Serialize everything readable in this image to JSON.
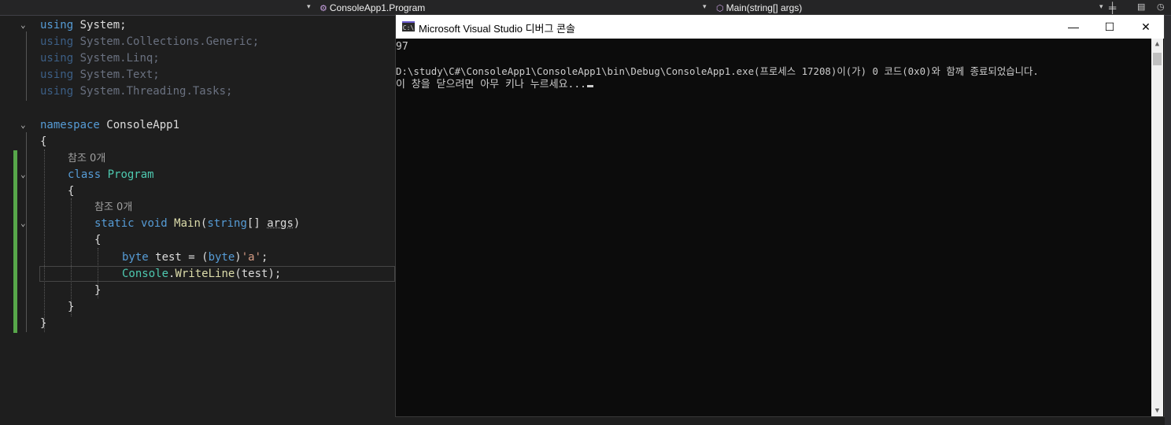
{
  "navbar": {
    "class_combo": "ConsoleApp1.Program",
    "member_combo": "Main(string[] args)",
    "split_icon": "split-icon"
  },
  "editor": {
    "lines": {
      "l1": {
        "kw": "using",
        "rest": " System;"
      },
      "l2": {
        "kw": "using",
        "rest": " System.Collections.Generic;"
      },
      "l3": {
        "kw": "using",
        "rest": " System.Linq;"
      },
      "l4": {
        "kw": "using",
        "rest": " System.Text;"
      },
      "l5": {
        "kw": "using",
        "rest": " System.Threading.Tasks;"
      },
      "l7": {
        "kw": "namespace",
        "rest": " ConsoleApp1"
      },
      "l8": "{",
      "ref1": "참조 0개",
      "l9": {
        "kw": "class",
        "type": "Program"
      },
      "l10": "{",
      "ref2": "참조 0개",
      "l11": {
        "kw1": "static",
        "kw2": "void",
        "meth": "Main",
        "p1": "(",
        "kw3": "string",
        "p2": "[] ",
        "param": "args",
        "p3": ")"
      },
      "l12": "{",
      "l13": {
        "kw": "byte",
        "id": " test = (",
        "kw2": "byte",
        "p": ")",
        "str": "'a'",
        "end": ";"
      },
      "l14": {
        "type": "Console",
        "dot": ".",
        "meth": "WriteLine",
        "args": "(test);"
      },
      "l15": "}",
      "l16": "}",
      "l17": "}"
    }
  },
  "console": {
    "title": "Microsoft Visual Studio 디버그 콘솔",
    "icon_text": "C:\\",
    "output_line1": "97",
    "output_line2": "D:\\study\\C#\\ConsoleApp1\\ConsoleApp1\\bin\\Debug\\ConsoleApp1.exe(프로세스 17208)이(가) 0 코드(0x0)와 함께 종료되었습니다.",
    "output_line3": "이 창을 닫으려면 아무 키나 누르세요...",
    "minimize": "—",
    "maximize": "☐",
    "close": "✕"
  }
}
